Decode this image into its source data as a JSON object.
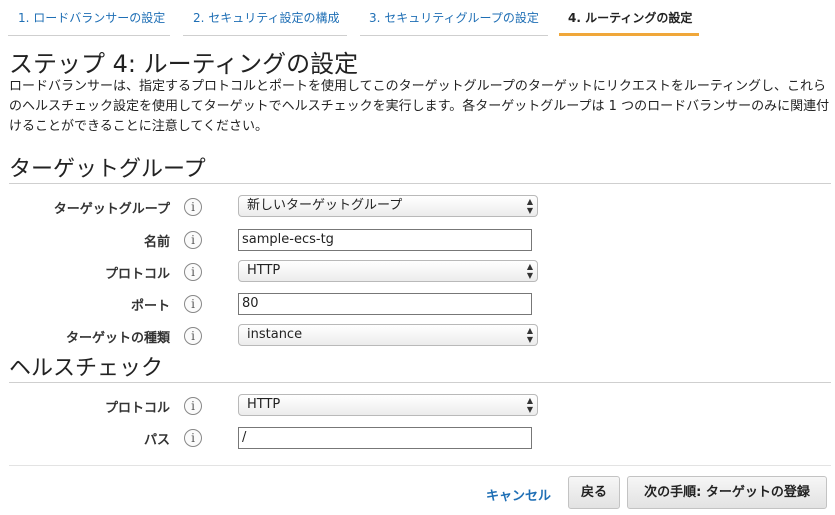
{
  "tabs": [
    {
      "label": "1. ロードバランサーの設定",
      "active": false
    },
    {
      "label": "2. セキュリティ設定の構成",
      "active": false
    },
    {
      "label": "3. セキュリティグループの設定",
      "active": false
    },
    {
      "label": "4. ルーティングの設定",
      "active": true
    }
  ],
  "page": {
    "title": "ステップ 4: ルーティングの設定",
    "description": "ロードバランサーは、指定するプロトコルとポートを使用してこのターゲットグループのターゲットにリクエストをルーティングし、これらのヘルスチェック設定を使用してターゲットでヘルスチェックを実行します。各ターゲットグループは 1 つのロードバランサーのみに関連付けることができることに注意してください。"
  },
  "target_group": {
    "section_title": "ターゲットグループ",
    "target_group_label": "ターゲットグループ",
    "target_group_value": "新しいターゲットグループ",
    "name_label": "名前",
    "name_value": "sample-ecs-tg",
    "protocol_label": "プロトコル",
    "protocol_value": "HTTP",
    "port_label": "ポート",
    "port_value": "80",
    "target_type_label": "ターゲットの種類",
    "target_type_value": "instance"
  },
  "health_check": {
    "section_title": "ヘルスチェック",
    "protocol_label": "プロトコル",
    "protocol_value": "HTTP",
    "path_label": "パス",
    "path_value": "/"
  },
  "info_glyph": "i",
  "footer": {
    "cancel_label": "キャンセル",
    "back_label": "戻る",
    "next_label": "次の手順: ターゲットの登録"
  }
}
